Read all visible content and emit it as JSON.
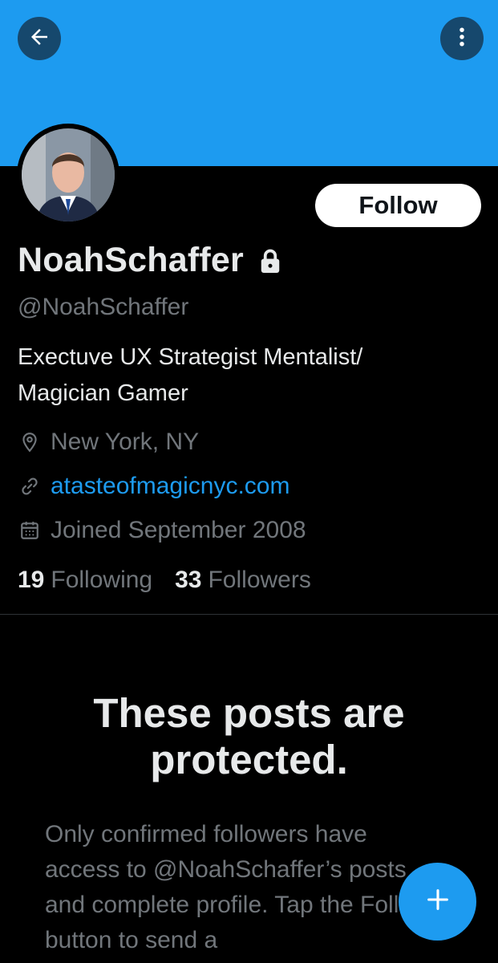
{
  "header": {
    "back_icon": "arrow-left-icon",
    "more_icon": "more-vertical-icon",
    "banner_color": "#1d9bf0"
  },
  "profile": {
    "display_name": "NoahSchaffer",
    "protected_icon": "lock-icon",
    "handle": "@NoahSchaffer",
    "bio_line1": "Exectuve UX Strategist Mentalist/",
    "bio_line2": "Magician Gamer",
    "location_icon": "location-pin-icon",
    "location": "New York, NY",
    "link_icon": "link-icon",
    "website": "atasteofmagicnyc.com",
    "joined_icon": "calendar-icon",
    "joined": "Joined September 2008",
    "following_count": "19",
    "following_label": "Following",
    "followers_count": "33",
    "followers_label": "Followers"
  },
  "actions": {
    "follow_label": "Follow",
    "compose_icon": "plus-icon"
  },
  "protected_notice": {
    "title": "These posts are protected.",
    "body": "Only confirmed followers have access to @NoahSchaffer’s posts and complete profile. Tap the Follow button to send a"
  },
  "colors": {
    "accent": "#1d9bf0",
    "background": "#000000",
    "text_primary": "#e7e9ea",
    "text_secondary": "#71767b"
  }
}
